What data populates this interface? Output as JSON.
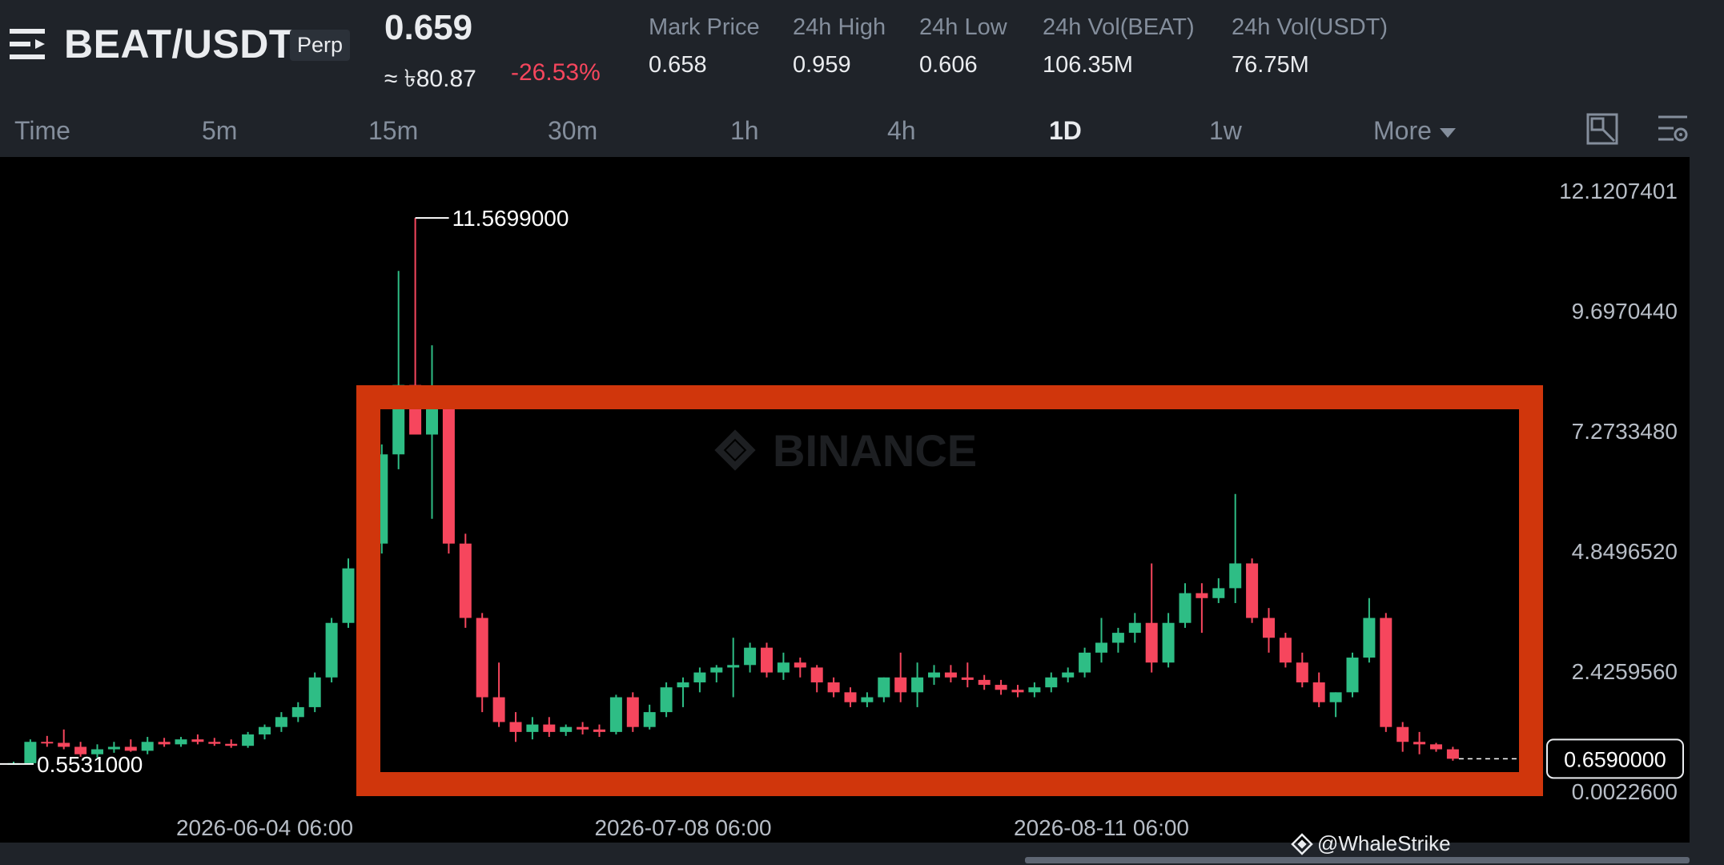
{
  "header": {
    "pair": "BEAT/USDT",
    "contract_type": "Perp",
    "last_price": "0.659",
    "fiat_price": "≈ ৳80.87",
    "change_pct": "-26.53%",
    "stats": [
      {
        "label": "Mark Price",
        "value": "0.658"
      },
      {
        "label": "24h High",
        "value": "0.959"
      },
      {
        "label": "24h Low",
        "value": "0.606"
      },
      {
        "label": "24h Vol(BEAT)",
        "value": "106.35M"
      },
      {
        "label": "24h Vol(USDT)",
        "value": "76.75M"
      }
    ],
    "icons": [
      "menu-icon"
    ]
  },
  "timeframes": {
    "items": [
      "Time",
      "5m",
      "15m",
      "30m",
      "1h",
      "4h",
      "1D",
      "1w"
    ],
    "active": "1D",
    "more_label": "More",
    "icons": [
      "fullscreen-icon",
      "chart-settings-icon"
    ]
  },
  "chart_data": {
    "type": "candlestick",
    "exchange_watermark": "BINANCE",
    "y_axis_ticks": [
      "12.1207401",
      "9.6970440",
      "7.2733480",
      "4.8496520",
      "2.4259560",
      "0.0022600"
    ],
    "x_axis_ticks": [
      "2026-06-04 06:00",
      "2026-07-08 06:00",
      "2026-08-11 06:00"
    ],
    "high_label": "11.5699000",
    "low_label": "0.5531000",
    "last_price_label": "0.6590000",
    "colors": {
      "up": "#2ebd85",
      "down": "#f6465d",
      "highlight_box": "#d0360c",
      "background": "#000000"
    },
    "candles": [
      [
        0.56,
        0.6,
        0.55,
        0.57
      ],
      [
        0.57,
        1.05,
        0.56,
        1.0
      ],
      [
        1.0,
        1.12,
        0.9,
        0.98
      ],
      [
        0.98,
        1.25,
        0.85,
        0.9
      ],
      [
        0.9,
        1.0,
        0.7,
        0.75
      ],
      [
        0.75,
        0.95,
        0.68,
        0.85
      ],
      [
        0.85,
        1.0,
        0.78,
        0.9
      ],
      [
        0.9,
        1.05,
        0.8,
        0.82
      ],
      [
        0.82,
        1.1,
        0.75,
        1.0
      ],
      [
        1.0,
        1.08,
        0.9,
        0.95
      ],
      [
        0.95,
        1.1,
        0.9,
        1.05
      ],
      [
        1.05,
        1.15,
        0.95,
        1.0
      ],
      [
        1.0,
        1.08,
        0.92,
        0.96
      ],
      [
        0.96,
        1.05,
        0.88,
        0.92
      ],
      [
        0.92,
        1.2,
        0.88,
        1.15
      ],
      [
        1.15,
        1.35,
        1.05,
        1.3
      ],
      [
        1.3,
        1.6,
        1.2,
        1.5
      ],
      [
        1.5,
        1.8,
        1.4,
        1.7
      ],
      [
        1.7,
        2.4,
        1.6,
        2.3
      ],
      [
        2.3,
        3.5,
        2.2,
        3.4
      ],
      [
        3.4,
        4.7,
        3.3,
        4.5
      ],
      [
        4.5,
        5.3,
        4.3,
        5.0
      ],
      [
        5.0,
        7.0,
        4.8,
        6.8
      ],
      [
        6.8,
        10.5,
        6.5,
        8.2
      ],
      [
        8.2,
        11.57,
        7.2,
        7.2
      ],
      [
        7.2,
        9.0,
        5.5,
        7.8
      ],
      [
        7.8,
        7.9,
        4.8,
        5.0
      ],
      [
        5.0,
        5.2,
        3.3,
        3.5
      ],
      [
        3.5,
        3.6,
        1.6,
        1.9
      ],
      [
        1.9,
        2.6,
        1.3,
        1.4
      ],
      [
        1.4,
        1.6,
        1.0,
        1.2
      ],
      [
        1.2,
        1.5,
        1.05,
        1.35
      ],
      [
        1.35,
        1.5,
        1.1,
        1.2
      ],
      [
        1.2,
        1.35,
        1.12,
        1.3
      ],
      [
        1.3,
        1.4,
        1.15,
        1.25
      ],
      [
        1.25,
        1.35,
        1.1,
        1.2
      ],
      [
        1.2,
        1.95,
        1.15,
        1.9
      ],
      [
        1.9,
        2.0,
        1.2,
        1.3
      ],
      [
        1.3,
        1.75,
        1.25,
        1.6
      ],
      [
        1.6,
        2.2,
        1.5,
        2.1
      ],
      [
        2.1,
        2.3,
        1.7,
        2.2
      ],
      [
        2.2,
        2.5,
        2.0,
        2.4
      ],
      [
        2.4,
        2.55,
        2.2,
        2.5
      ],
      [
        2.5,
        3.1,
        1.9,
        2.55
      ],
      [
        2.55,
        3.0,
        2.4,
        2.9
      ],
      [
        2.9,
        3.0,
        2.3,
        2.4
      ],
      [
        2.4,
        2.8,
        2.25,
        2.6
      ],
      [
        2.6,
        2.7,
        2.3,
        2.5
      ],
      [
        2.5,
        2.55,
        2.0,
        2.2
      ],
      [
        2.2,
        2.3,
        1.9,
        2.0
      ],
      [
        2.0,
        2.1,
        1.7,
        1.8
      ],
      [
        1.8,
        2.0,
        1.7,
        1.9
      ],
      [
        1.9,
        2.3,
        1.8,
        2.3
      ],
      [
        2.3,
        2.8,
        1.8,
        2.0
      ],
      [
        2.0,
        2.6,
        1.7,
        2.3
      ],
      [
        2.3,
        2.55,
        2.15,
        2.4
      ],
      [
        2.4,
        2.55,
        2.2,
        2.3
      ],
      [
        2.3,
        2.6,
        2.1,
        2.25
      ],
      [
        2.25,
        2.35,
        2.05,
        2.15
      ],
      [
        2.15,
        2.25,
        1.95,
        2.05
      ],
      [
        2.05,
        2.15,
        1.9,
        2.0
      ],
      [
        2.0,
        2.2,
        1.9,
        2.1
      ],
      [
        2.1,
        2.4,
        2.0,
        2.3
      ],
      [
        2.3,
        2.5,
        2.2,
        2.4
      ],
      [
        2.4,
        2.9,
        2.3,
        2.8
      ],
      [
        2.8,
        3.5,
        2.6,
        3.0
      ],
      [
        3.0,
        3.3,
        2.8,
        3.2
      ],
      [
        3.2,
        3.6,
        3.0,
        3.4
      ],
      [
        3.4,
        4.6,
        2.4,
        2.6
      ],
      [
        2.6,
        3.6,
        2.5,
        3.4
      ],
      [
        3.4,
        4.2,
        3.3,
        4.0
      ],
      [
        4.0,
        4.2,
        3.2,
        3.9
      ],
      [
        3.9,
        4.3,
        3.8,
        4.1
      ],
      [
        4.1,
        6.0,
        3.8,
        4.6
      ],
      [
        4.6,
        4.7,
        3.4,
        3.5
      ],
      [
        3.5,
        3.7,
        2.8,
        3.1
      ],
      [
        3.1,
        3.2,
        2.5,
        2.6
      ],
      [
        2.6,
        2.8,
        2.1,
        2.2
      ],
      [
        2.2,
        2.4,
        1.7,
        1.8
      ],
      [
        1.8,
        2.0,
        1.5,
        2.0
      ],
      [
        2.0,
        2.8,
        1.9,
        2.7
      ],
      [
        2.7,
        3.9,
        2.6,
        3.5
      ],
      [
        3.5,
        3.6,
        1.2,
        1.3
      ],
      [
        1.3,
        1.4,
        0.8,
        1.0
      ],
      [
        1.0,
        1.2,
        0.75,
        0.95
      ],
      [
        0.95,
        0.98,
        0.8,
        0.85
      ],
      [
        0.85,
        0.9,
        0.62,
        0.659
      ]
    ]
  },
  "footer": {
    "credit": "@WhaleStrike",
    "icons": [
      "whalestrike-logo-icon"
    ]
  }
}
